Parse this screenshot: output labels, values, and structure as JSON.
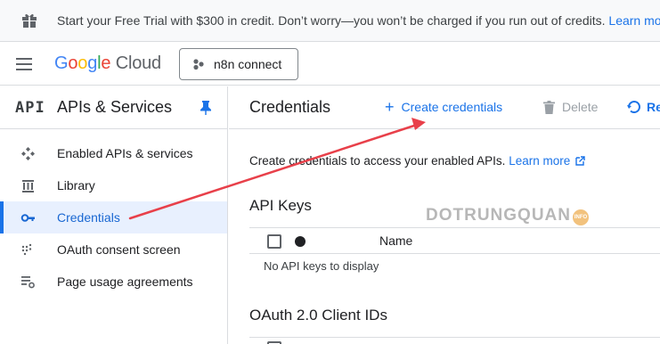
{
  "banner": {
    "text": "Start your Free Trial with $300 in credit. Don’t worry—you won’t be charged if you run out of credits.",
    "link": "Learn mor"
  },
  "header": {
    "logo_google": [
      "G",
      "o",
      "o",
      "g",
      "l",
      "e"
    ],
    "logo_cloud": "Cloud",
    "project": "n8n connect"
  },
  "sidebar": {
    "icon_text": "API",
    "title": "APIs & Services",
    "items": [
      {
        "label": "Enabled APIs & services",
        "icon": "hub-icon",
        "active": false
      },
      {
        "label": "Library",
        "icon": "library-icon",
        "active": false
      },
      {
        "label": "Credentials",
        "icon": "key-icon",
        "active": true
      },
      {
        "label": "OAuth consent screen",
        "icon": "oauth-icon",
        "active": false
      },
      {
        "label": "Page usage agreements",
        "icon": "settings-list-icon",
        "active": false
      }
    ]
  },
  "main": {
    "title": "Credentials",
    "create_label": "Create credentials",
    "delete_label": "Delete",
    "restore_label": "Re",
    "description": "Create credentials to access your enabled APIs.",
    "learn_more": "Learn more",
    "api_keys_heading": "API Keys",
    "table_col_name": "Name",
    "empty_text": "No API keys to display",
    "oauth_heading": "OAuth 2.0 Client IDs"
  },
  "watermark": {
    "text": "DOTRUNGQUAN",
    "badge": "INFO"
  },
  "colors": {
    "accent": "#1a73e8",
    "annotation_arrow": "#e8404a",
    "active_bg": "#e8f0fe"
  }
}
